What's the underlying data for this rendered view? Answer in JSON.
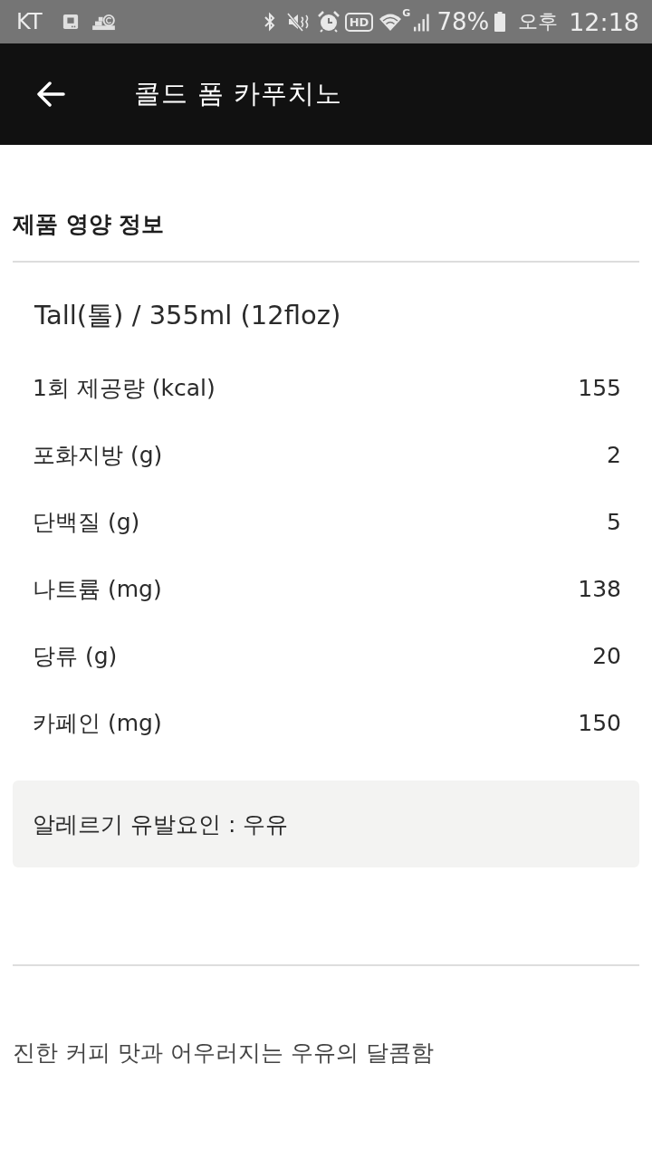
{
  "status_bar": {
    "carrier": "KT",
    "hd_label": "HD",
    "network_type": "G",
    "battery": "78%",
    "period": "오후",
    "time": "12:18"
  },
  "app_bar": {
    "title": "콜드 폼 카푸치노"
  },
  "nutrition": {
    "heading": "제품 영양 정보",
    "size": "Tall(톨) / 355ml (12floz)",
    "rows": [
      {
        "label": "1회 제공량 (kcal)",
        "value": "155"
      },
      {
        "label": "포화지방 (g)",
        "value": "2"
      },
      {
        "label": "단백질 (g)",
        "value": "5"
      },
      {
        "label": "나트륨 (mg)",
        "value": "138"
      },
      {
        "label": "당류 (g)",
        "value": "20"
      },
      {
        "label": "카페인 (mg)",
        "value": "150"
      }
    ],
    "allergy": "알레르기 유발요인 : 우유"
  },
  "description": "진한 커피 맛과 어우러지는 우유의 달콤함"
}
